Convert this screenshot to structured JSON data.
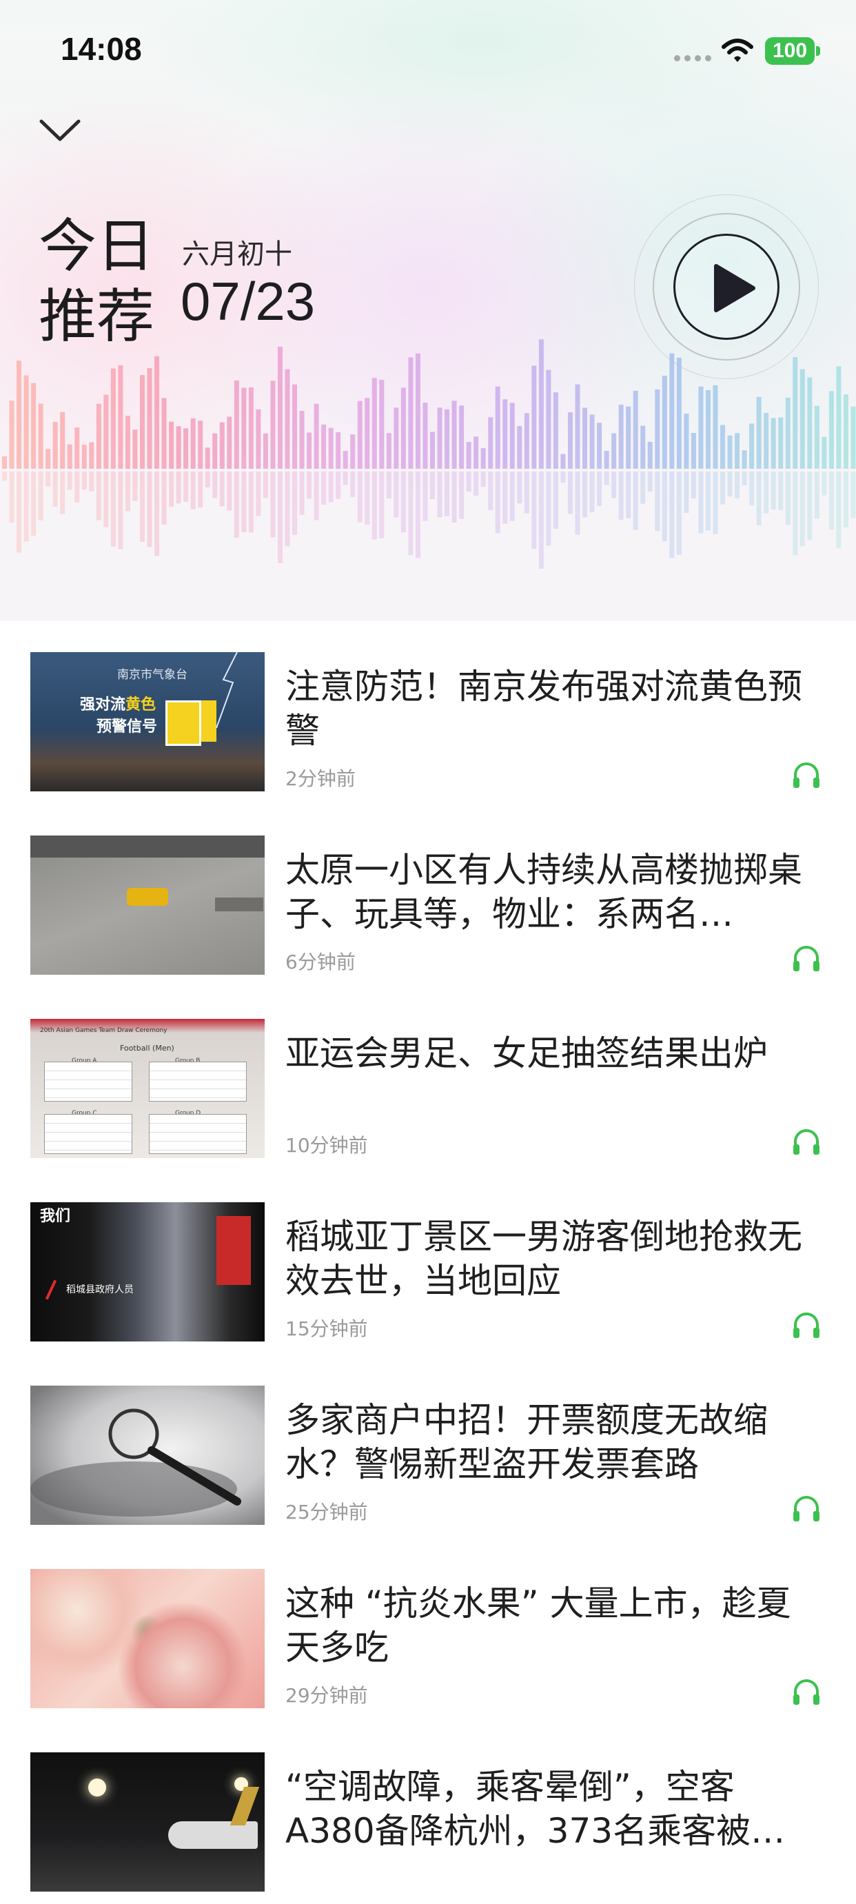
{
  "status_bar": {
    "time": "14:08",
    "battery": "100"
  },
  "hero": {
    "title_line1": "今日",
    "title_line2": "推荐",
    "lunar_date": "六月初十",
    "date": "07/23"
  },
  "colors": {
    "accent_green": "#3cc14f",
    "text_dark": "#1f1f1f",
    "meta_gray": "#9a9a9a"
  },
  "news": [
    {
      "title": "注意防范！南京发布强对流黄色预警",
      "time": "2分钟前",
      "thumb_text": [
        "南京市气象台",
        "强对流",
        "黄色",
        "预警信号"
      ]
    },
    {
      "title": "太原一小区有人持续从高楼抛掷桌子、玩具等，物业：系两名…",
      "time": "6分钟前"
    },
    {
      "title": "亚运会男足、女足抽签结果出炉",
      "time": "10分钟前",
      "thumb_text": [
        "20th Asian Games Team Draw Ceremony",
        "Football (Men)",
        "Group A",
        "Group B",
        "Group C",
        "Group D"
      ]
    },
    {
      "title": "稻城亚丁景区一男游客倒地抢救无效去世，当地回应",
      "time": "15分钟前",
      "thumb_text": [
        "我们",
        "稻城县政府人员"
      ]
    },
    {
      "title": "多家商户中招！开票额度无故缩水？警惕新型盗开发票套路",
      "time": "25分钟前"
    },
    {
      "title": "这种 “抗炎水果” 大量上市，趁夏天多吃",
      "time": "29分钟前"
    },
    {
      "title": "“空调故障，乘客晕倒”，空客A380备降杭州，373名乘客被…",
      "time": ""
    }
  ]
}
